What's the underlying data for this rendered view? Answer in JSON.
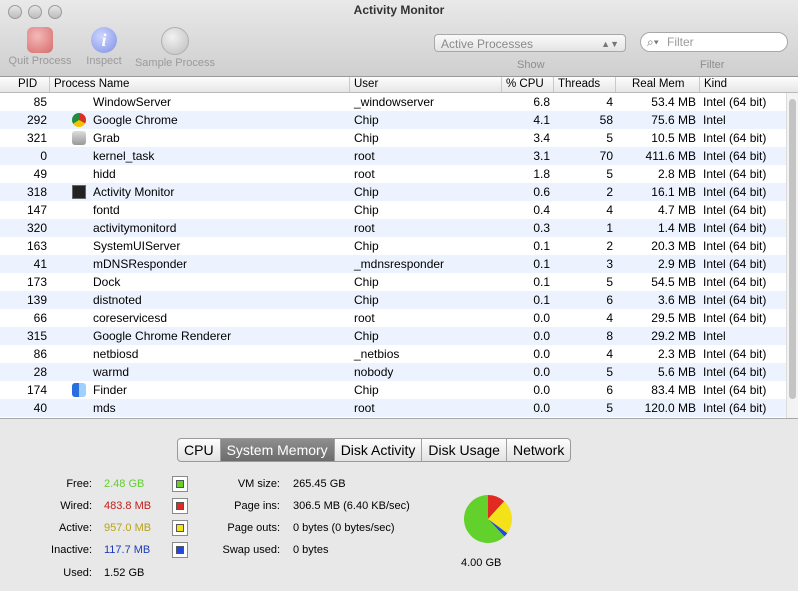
{
  "window": {
    "title": "Activity Monitor"
  },
  "toolbar": {
    "quit_label": "Quit Process",
    "inspect_label": "Inspect",
    "inspect_glyph": "i",
    "sample_label": "Sample Process",
    "show_value": "Active Processes",
    "show_label": "Show",
    "filter_placeholder": "Filter",
    "filter_label": "Filter"
  },
  "table": {
    "columns": {
      "pid": "PID",
      "name": "Process Name",
      "user": "User",
      "cpu": "% CPU",
      "threads": "Threads",
      "mem": "Real Mem",
      "kind": "Kind"
    },
    "sort_indicator": "▼",
    "rows": [
      {
        "pid": "85",
        "name": "WindowServer",
        "user": "_windowserver",
        "cpu": "6.8",
        "threads": "4",
        "mem": "53.4 MB",
        "kind": "Intel (64 bit)",
        "icon": ""
      },
      {
        "pid": "292",
        "name": "Google Chrome",
        "user": "Chip",
        "cpu": "4.1",
        "threads": "58",
        "mem": "75.6 MB",
        "kind": "Intel",
        "icon": "chrome-icon"
      },
      {
        "pid": "321",
        "name": "Grab",
        "user": "Chip",
        "cpu": "3.4",
        "threads": "5",
        "mem": "10.5 MB",
        "kind": "Intel (64 bit)",
        "icon": "grab-icon"
      },
      {
        "pid": "0",
        "name": "kernel_task",
        "user": "root",
        "cpu": "3.1",
        "threads": "70",
        "mem": "411.6 MB",
        "kind": "Intel (64 bit)",
        "icon": ""
      },
      {
        "pid": "49",
        "name": "hidd",
        "user": "root",
        "cpu": "1.8",
        "threads": "5",
        "mem": "2.8 MB",
        "kind": "Intel (64 bit)",
        "icon": ""
      },
      {
        "pid": "318",
        "name": "Activity Monitor",
        "user": "Chip",
        "cpu": "0.6",
        "threads": "2",
        "mem": "16.1 MB",
        "kind": "Intel (64 bit)",
        "icon": "activity-monitor-icon"
      },
      {
        "pid": "147",
        "name": "fontd",
        "user": "Chip",
        "cpu": "0.4",
        "threads": "4",
        "mem": "4.7 MB",
        "kind": "Intel (64 bit)",
        "icon": ""
      },
      {
        "pid": "320",
        "name": "activitymonitord",
        "user": "root",
        "cpu": "0.3",
        "threads": "1",
        "mem": "1.4 MB",
        "kind": "Intel (64 bit)",
        "icon": ""
      },
      {
        "pid": "163",
        "name": "SystemUIServer",
        "user": "Chip",
        "cpu": "0.1",
        "threads": "2",
        "mem": "20.3 MB",
        "kind": "Intel (64 bit)",
        "icon": ""
      },
      {
        "pid": "41",
        "name": "mDNSResponder",
        "user": "_mdnsresponder",
        "cpu": "0.1",
        "threads": "3",
        "mem": "2.9 MB",
        "kind": "Intel (64 bit)",
        "icon": ""
      },
      {
        "pid": "173",
        "name": "Dock",
        "user": "Chip",
        "cpu": "0.1",
        "threads": "5",
        "mem": "54.5 MB",
        "kind": "Intel (64 bit)",
        "icon": ""
      },
      {
        "pid": "139",
        "name": "distnoted",
        "user": "Chip",
        "cpu": "0.1",
        "threads": "6",
        "mem": "3.6 MB",
        "kind": "Intel (64 bit)",
        "icon": ""
      },
      {
        "pid": "66",
        "name": "coreservicesd",
        "user": "root",
        "cpu": "0.0",
        "threads": "4",
        "mem": "29.5 MB",
        "kind": "Intel (64 bit)",
        "icon": ""
      },
      {
        "pid": "315",
        "name": "Google Chrome Renderer",
        "user": "Chip",
        "cpu": "0.0",
        "threads": "8",
        "mem": "29.2 MB",
        "kind": "Intel",
        "icon": ""
      },
      {
        "pid": "86",
        "name": "netbiosd",
        "user": "_netbios",
        "cpu": "0.0",
        "threads": "4",
        "mem": "2.3 MB",
        "kind": "Intel (64 bit)",
        "icon": ""
      },
      {
        "pid": "28",
        "name": "warmd",
        "user": "nobody",
        "cpu": "0.0",
        "threads": "5",
        "mem": "5.6 MB",
        "kind": "Intel (64 bit)",
        "icon": ""
      },
      {
        "pid": "174",
        "name": "Finder",
        "user": "Chip",
        "cpu": "0.0",
        "threads": "6",
        "mem": "83.4 MB",
        "kind": "Intel (64 bit)",
        "icon": "finder-icon"
      },
      {
        "pid": "40",
        "name": "mds",
        "user": "root",
        "cpu": "0.0",
        "threads": "5",
        "mem": "120.0 MB",
        "kind": "Intel (64 bit)",
        "icon": ""
      }
    ]
  },
  "tabs": [
    {
      "label": "CPU",
      "selected": false
    },
    {
      "label": "System Memory",
      "selected": true
    },
    {
      "label": "Disk Activity",
      "selected": false
    },
    {
      "label": "Disk Usage",
      "selected": false
    },
    {
      "label": "Network",
      "selected": false
    }
  ],
  "memory": {
    "free": {
      "label": "Free:",
      "value": "2.48 GB",
      "color": "#5fd02c",
      "swatch": "#62d12b"
    },
    "wired": {
      "label": "Wired:",
      "value": "483.8 MB",
      "color": "#c0201c",
      "swatch": "#e02a22"
    },
    "active": {
      "label": "Active:",
      "value": "957.0 MB",
      "color": "#b7a318",
      "swatch": "#f3e21a"
    },
    "inactive": {
      "label": "Inactive:",
      "value": "117.7 MB",
      "color": "#1d3bb8",
      "swatch": "#2046e6"
    },
    "used": {
      "label": "Used:",
      "value": "1.52 GB"
    },
    "vm_size": {
      "label": "VM size:",
      "value": "265.45 GB"
    },
    "page_ins": {
      "label": "Page ins:",
      "value": "306.5 MB (6.40 KB/sec)"
    },
    "page_outs": {
      "label": "Page outs:",
      "value": "0 bytes (0 bytes/sec)"
    },
    "swap_used": {
      "label": "Swap used:",
      "value": "0 bytes"
    },
    "total": "4.00 GB"
  }
}
